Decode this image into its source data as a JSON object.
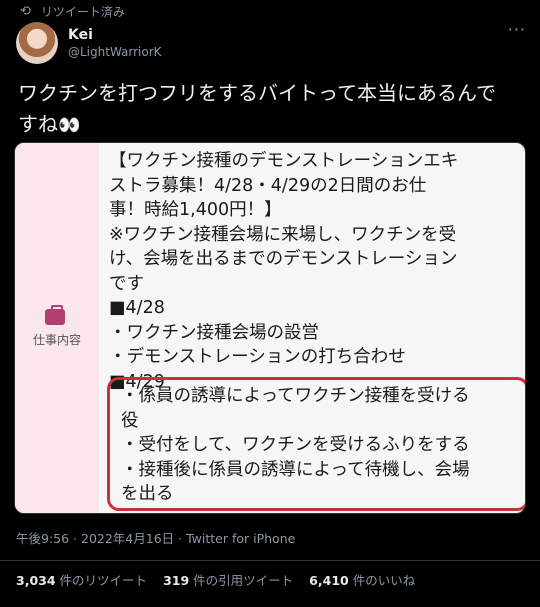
{
  "retweet_bar": {
    "icon": "retweet-icon",
    "label": "リツイート済み"
  },
  "user": {
    "name": "Kei",
    "handle": "@LightWarriorK",
    "more": "···"
  },
  "tweet": {
    "text": "ワクチンを打つフリをするバイトって本当にあるんで",
    "text2": "すね",
    "eyes": "👀"
  },
  "media": {
    "sidebar_label": "仕事内容",
    "body": "【ワクチン接種のデモンストレーションエキ\nストラ募集！4/28・4/29の2日間のお仕\n事！時給1,400円！】\n※ワクチン接種会場に来場し、ワクチンを受\nけ、会場を出るまでのデモンストレーション\nです\n■4/28\n・ワクチン接種会場の設営\n・デモンストレーションの打ち合わせ\n■4/29",
    "highlight": "・係員の誘導によってワクチン接種を受ける\n役\n・受付をして、ワクチンを受けるふりをする\n・接種後に係員の誘導によって待機し、会場\nを出る"
  },
  "meta": "午後9:56 · 2022年4月16日 · Twitter for iPhone",
  "stats": [
    {
      "num": "3,034",
      "label": "件のリツイート"
    },
    {
      "num": "319",
      "label": "件の引用ツイート"
    },
    {
      "num": "6,410",
      "label": "件のいいね"
    }
  ]
}
